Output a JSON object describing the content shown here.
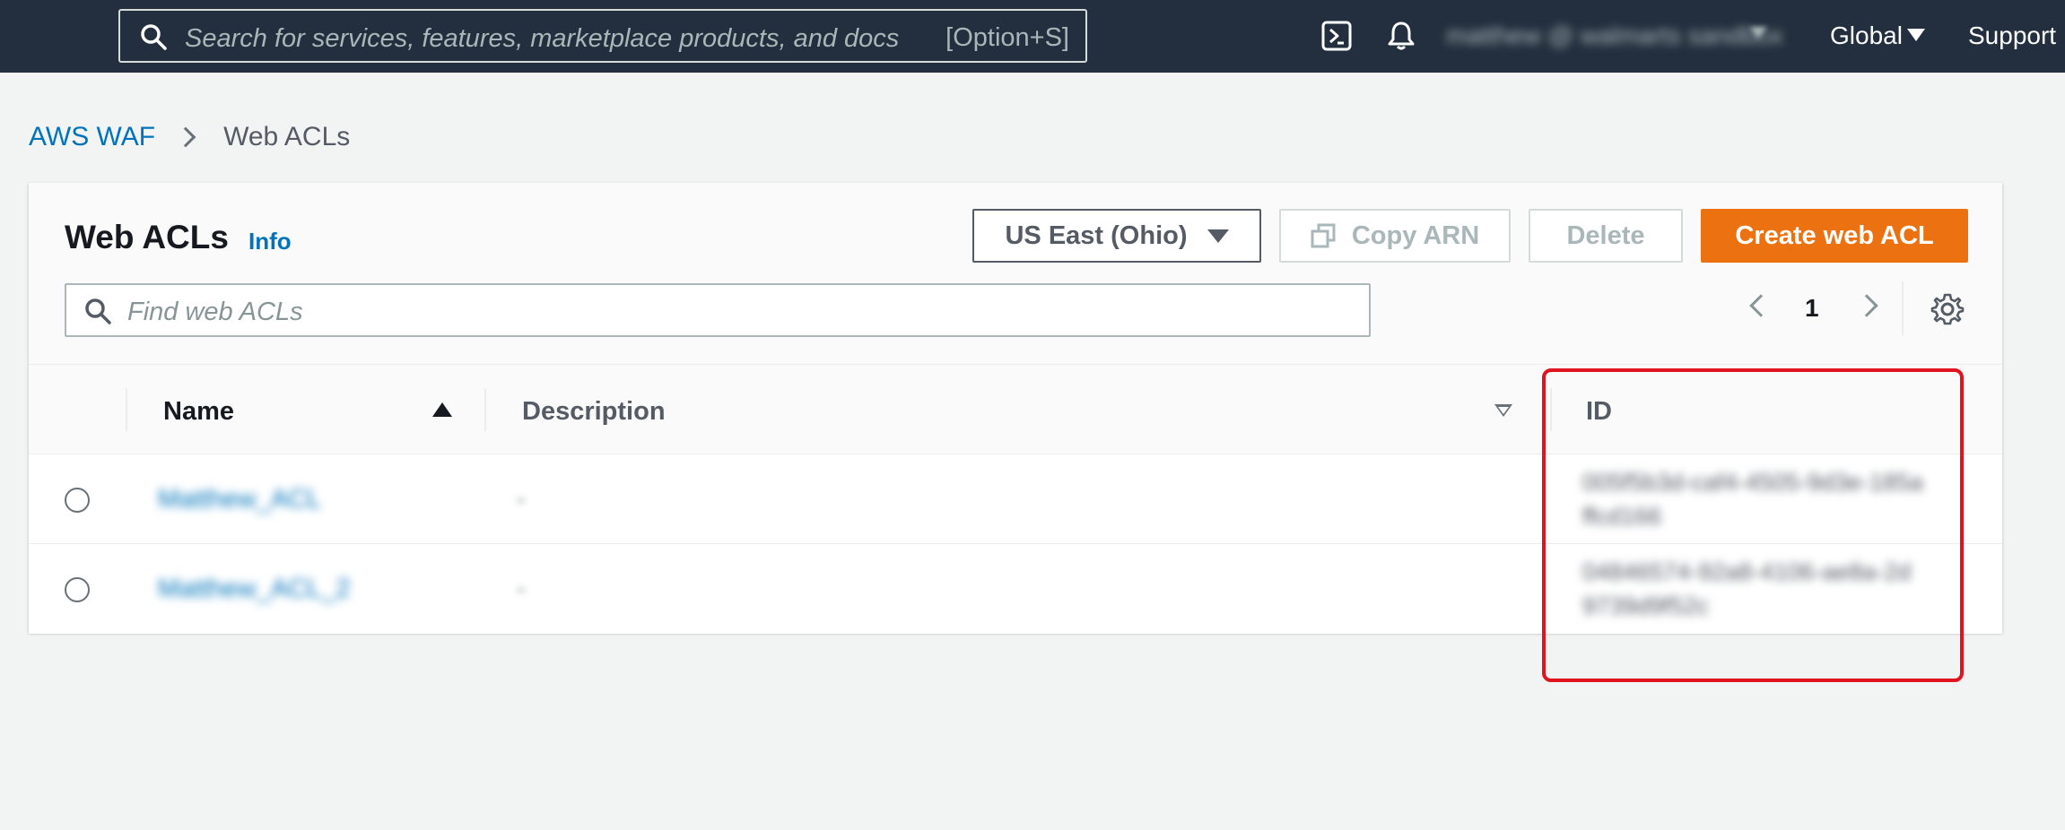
{
  "topnav": {
    "search_placeholder": "Search for services, features, marketplace products, and docs",
    "search_shortcut": "[Option+S]",
    "icons": [
      "cloudshell-icon",
      "bell-icon",
      "search-icon"
    ],
    "user_label": "matthew @ walmarts sandbox",
    "region_label": "Global",
    "support_label": "Support"
  },
  "breadcrumb": {
    "root": "AWS WAF",
    "current": "Web ACLs"
  },
  "panel": {
    "title": "Web ACLs",
    "info_label": "Info",
    "region_select": "US East (Ohio)",
    "copy_arn_label": "Copy ARN",
    "delete_label": "Delete",
    "create_label": "Create web ACL",
    "filter_placeholder": "Find web ACLs",
    "page_number": "1"
  },
  "table": {
    "columns": {
      "name": "Name",
      "description": "Description",
      "id": "ID"
    },
    "rows": [
      {
        "name": "Matthew_ACL",
        "description": "-",
        "id": "005f5b3d-caf4-4505-9d3e-185affcd166"
      },
      {
        "name": "Matthew_ACL_2",
        "description": "-",
        "id": "04846574-92a8-4106-ae8a-2d9739d9f52c"
      }
    ]
  },
  "colors": {
    "nav_bg": "#232f3e",
    "link": "#0073bb",
    "primary_button": "#ec7211",
    "highlight": "#e0131f"
  }
}
